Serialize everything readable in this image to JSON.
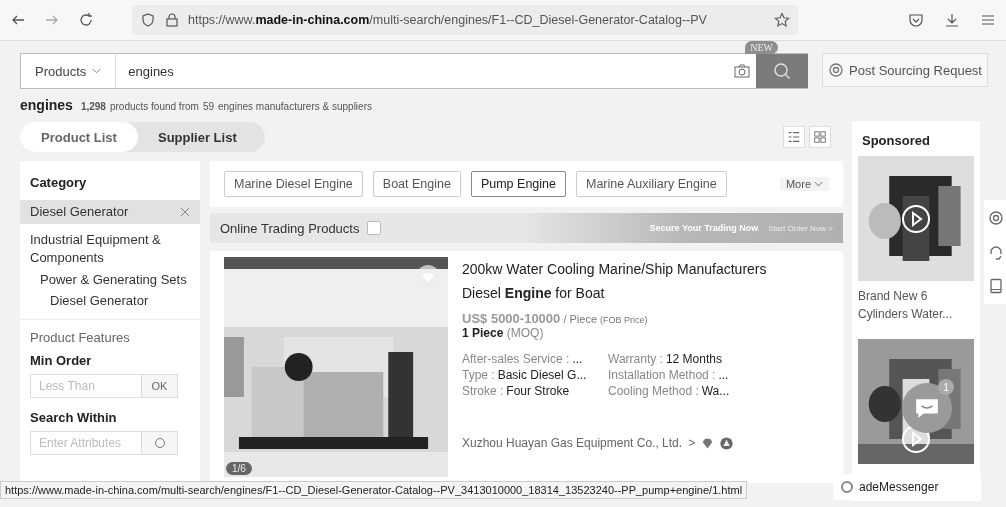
{
  "browser": {
    "url": "https://www.**made-in-china.com**/multi-search/engines/F1--CD_Diesel-Generator-Catalog--PV"
  },
  "search": {
    "scope": "Products",
    "value": "engines",
    "new_badge": "NEW",
    "post_button": "Post Sourcing Request"
  },
  "summary": {
    "keyword": "engines",
    "count": "1,298",
    "text_1": "products found from",
    "suppliers": "59",
    "text_2": "engines manufacturers & suppliers"
  },
  "tabs": [
    {
      "label": "Product List",
      "selected": true
    },
    {
      "label": "Supplier List",
      "selected": false
    }
  ],
  "sidebar": {
    "title": "Category",
    "items": [
      {
        "label": "Diesel Generator",
        "selected": true
      },
      {
        "label": "Industrial Equipment & Components",
        "selected": false,
        "children": [
          {
            "label": "Power & Generating Sets",
            "selected": false,
            "children": [
              {
                "label": "Diesel Generator",
                "selected": false
              }
            ]
          }
        ]
      }
    ],
    "features_title": "Product Features",
    "min_order_title": "Min Order",
    "min_order_placeholder": "Less Than",
    "ok_button": "OK",
    "search_within_title": "Search Within",
    "search_within_placeholder": "Enter Attributes"
  },
  "related": [
    {
      "label": "Marine Diesel Engine",
      "selected": false
    },
    {
      "label": "Boat Engine",
      "selected": false
    },
    {
      "label": "Pump Engine",
      "selected": true
    },
    {
      "label": "Marine Auxiliary Engine",
      "selected": false
    }
  ],
  "more_button": "More",
  "online_trading": {
    "label": "Online Trading Products",
    "checked": false,
    "banner_text": "Secure Your Trading Now",
    "banner_link": "Start Order Now >"
  },
  "product": {
    "title": "200kw Water Cooling Marine/Ship Manufacturers Diesel **Engine** for Boat",
    "price": "US$ 5000-10000",
    "unit": "/ Piece",
    "price_note": "(FOB Price)",
    "moq": "1 Piece",
    "moq_note": "(MOQ)",
    "details": [
      {
        "label": "After-sales Service :",
        "value": "..."
      },
      {
        "label": "Warranty :",
        "value": "12 Months"
      },
      {
        "label": "Type :",
        "value": "Basic Diesel G..."
      },
      {
        "label": "Installation Method :",
        "value": "..."
      },
      {
        "label": "Stroke :",
        "value": "Four Stroke"
      },
      {
        "label": "Cooling Method :",
        "value": "Wa..."
      }
    ],
    "supplier": "Xuzhou Huayan Gas Equipment Co., Ltd.",
    "supplier_arrow": ">",
    "image_counter": "1/6"
  },
  "sponsored": {
    "title": "Sponsored",
    "items": [
      {
        "kind": "video",
        "title": "Brand New 6 Cylinders Water..."
      },
      {
        "kind": "video"
      }
    ]
  },
  "chat_badge": "1",
  "messenger": "adeMessenger",
  "status_url": "https://www.made-in-china.com/multi-search/engines/F1--CD_Diesel-Generator-Catalog--PV_3413010000_18314_13523240--PP_pump+engine/1.html"
}
